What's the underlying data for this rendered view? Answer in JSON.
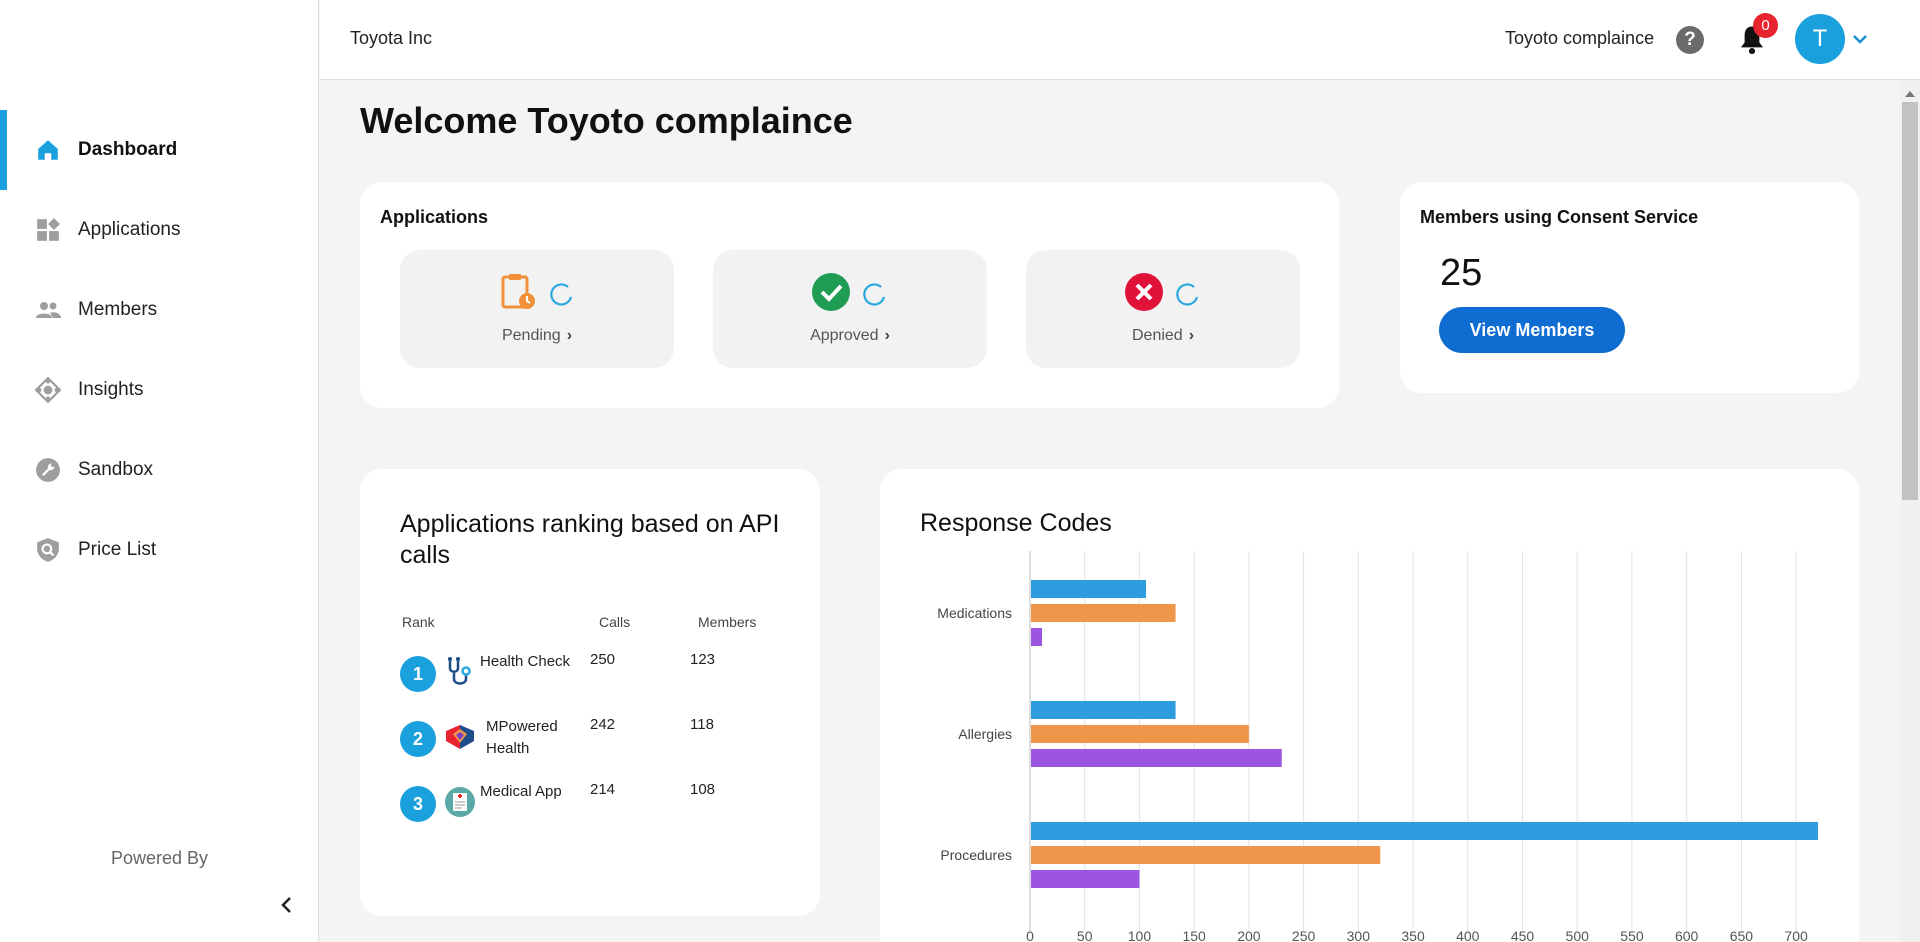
{
  "sidebar": {
    "items": [
      {
        "label": "Dashboard",
        "icon": "home-icon",
        "active": true
      },
      {
        "label": "Applications",
        "icon": "widgets-icon"
      },
      {
        "label": "Members",
        "icon": "people-icon"
      },
      {
        "label": "Insights",
        "icon": "insights-icon"
      },
      {
        "label": "Sandbox",
        "icon": "wrench-icon"
      },
      {
        "label": "Price List",
        "icon": "shield-search-icon"
      }
    ],
    "powered_by": "Powered By"
  },
  "header": {
    "org": "Toyota Inc",
    "user_name": "Toyoto complaince",
    "help": "?",
    "notification_count": "0",
    "avatar_initial": "T"
  },
  "main": {
    "welcome": "Welcome Toyoto complaince",
    "applications": {
      "title": "Applications",
      "stats": [
        {
          "label": "Pending",
          "icon": "clipboard-clock-icon",
          "color": "#f0913a"
        },
        {
          "label": "Approved",
          "icon": "check-circle-icon",
          "color": "#1f9d55"
        },
        {
          "label": "Denied",
          "icon": "x-circle-icon",
          "color": "#e0123a"
        }
      ]
    },
    "members": {
      "title": "Members using Consent Service",
      "count": "25",
      "button": "View Members"
    },
    "ranking": {
      "title": "Applications ranking based on API calls",
      "headers": {
        "rank": "Rank",
        "calls": "Calls",
        "members": "Members"
      },
      "rows": [
        {
          "rank": "1",
          "name": "Health Check",
          "calls": "250",
          "members": "123",
          "icon": "stethoscope-icon"
        },
        {
          "rank": "2",
          "name": "MPowered Health",
          "calls": "242",
          "members": "118",
          "icon": "mpowered-logo-icon"
        },
        {
          "rank": "3",
          "name": "Medical App",
          "calls": "214",
          "members": "108",
          "icon": "medical-app-icon"
        }
      ]
    },
    "response_codes": {
      "title": "Response Codes"
    }
  },
  "chart_data": {
    "type": "bar",
    "orientation": "horizontal",
    "title": "Response Codes",
    "categories": [
      "Medications",
      "Allergies",
      "Procedures"
    ],
    "series": [
      {
        "values": [
          106,
          133,
          720
        ],
        "color": "#2e9de0"
      },
      {
        "values": [
          133,
          200,
          320
        ],
        "color": "#f0964a"
      },
      {
        "values": [
          11,
          230,
          100
        ],
        "color": "#9b55e0"
      }
    ],
    "xlim": [
      0,
      720
    ],
    "ticks": [
      0,
      50,
      100,
      150,
      200,
      250,
      300,
      350,
      400,
      450,
      500,
      550,
      600,
      650,
      700
    ],
    "grid": true
  }
}
